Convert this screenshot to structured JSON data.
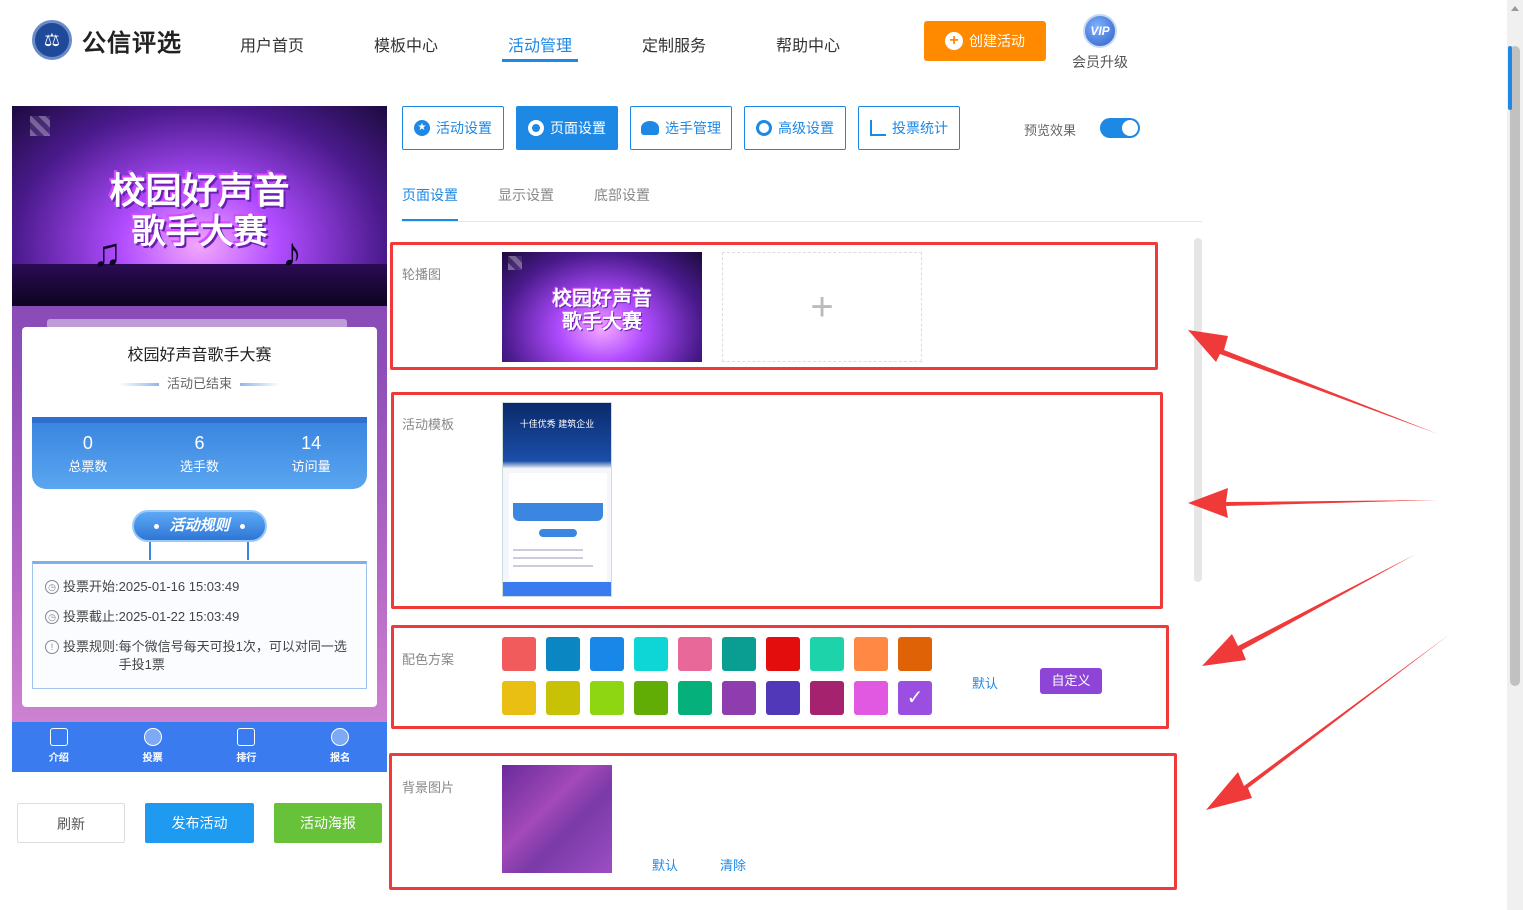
{
  "header": {
    "logo_text": "公信评选",
    "nav": [
      {
        "label": "用户首页"
      },
      {
        "label": "模板中心"
      },
      {
        "label": "活动管理"
      },
      {
        "label": "定制服务"
      },
      {
        "label": "帮助中心"
      }
    ],
    "active_nav": "活动管理",
    "create_button": "创建活动",
    "vip_badge": "VIP",
    "vip_label": "会员升级"
  },
  "preview": {
    "banner_line1": "校园好声音",
    "banner_line2": "歌手大赛",
    "activity_title": "校园好声音歌手大赛",
    "status": "活动已结束",
    "stats": [
      {
        "value": "0",
        "label": "总票数"
      },
      {
        "value": "6",
        "label": "选手数"
      },
      {
        "value": "14",
        "label": "访问量"
      }
    ],
    "rules_button": "活动规则",
    "vote_start_label": "投票开始:",
    "vote_start": "2025-01-16 15:03:49",
    "vote_end_label": "投票截止:",
    "vote_end": "2025-01-22 15:03:49",
    "vote_rule_label": "投票规则:",
    "vote_rule": "每个微信号每天可投1次，可以对同一选手投1票",
    "bottom_nav": [
      {
        "label": "介绍"
      },
      {
        "label": "投票"
      },
      {
        "label": "排行"
      },
      {
        "label": "报名"
      }
    ]
  },
  "actions": {
    "refresh": "刷新",
    "publish": "发布活动",
    "poster": "活动海报"
  },
  "toolbar": {
    "buttons": [
      {
        "label": "活动设置"
      },
      {
        "label": "页面设置"
      },
      {
        "label": "选手管理"
      },
      {
        "label": "高级设置"
      },
      {
        "label": "投票统计"
      }
    ],
    "active": "页面设置",
    "preview_label": "预览效果",
    "preview_on": true
  },
  "subtabs": [
    {
      "label": "页面设置"
    },
    {
      "label": "显示设置"
    },
    {
      "label": "底部设置"
    }
  ],
  "sections": {
    "carousel_label": "轮播图",
    "carousel_image_line1": "校园好声音",
    "carousel_image_line2": "歌手大赛",
    "add_symbol": "+",
    "template_label": "活动模板",
    "template_title": "十佳优秀 建筑企业",
    "color_label": "配色方案",
    "colors_row1": [
      "#f25b5b",
      "#0a86c2",
      "#1887e8",
      "#0fd6d6",
      "#e8689a",
      "#0a9e93",
      "#e30d0d",
      "#1dd3aa",
      "#ff8844",
      "#e06206"
    ],
    "colors_row2": [
      "#e9bf13",
      "#c7c206",
      "#8ed611",
      "#62ad05",
      "#06b07a",
      "#8f3cae",
      "#5038b8",
      "#a5226e",
      "#e159e1",
      "#9b4fe0"
    ],
    "selected_color": "#9b4fe0",
    "color_default": "默认",
    "color_custom": "自定义",
    "bg_label": "背景图片",
    "bg_default": "默认",
    "bg_clear": "清除"
  }
}
